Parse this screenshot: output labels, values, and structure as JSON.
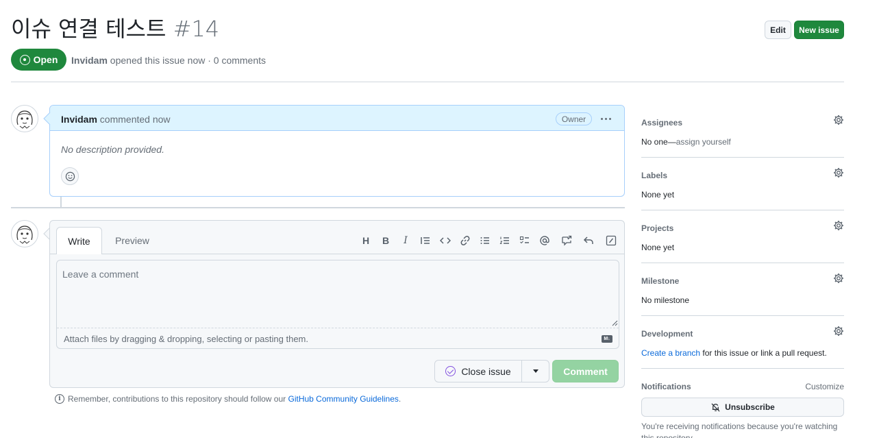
{
  "issue": {
    "title": "이슈 연결 테스트",
    "number": "#14",
    "state": "Open",
    "author": "Invidam",
    "opened_text": "opened this issue now · 0 comments"
  },
  "header_actions": {
    "edit_label": "Edit",
    "new_issue_label": "New issue"
  },
  "comment": {
    "author": "Invidam",
    "action": "commented now",
    "badge": "Owner",
    "body": "No description provided."
  },
  "composer": {
    "tab_write": "Write",
    "tab_preview": "Preview",
    "toolbar": [
      "heading-icon",
      "bold-icon",
      "italic-icon",
      "quote-icon",
      "code-icon",
      "link-icon",
      "bulleted-list-icon",
      "numbered-list-icon",
      "task-list-icon",
      "mention-icon",
      "cross-reference-icon",
      "reply-icon",
      "slash-command-icon"
    ],
    "heading_glyph": "H",
    "bold_glyph": "B",
    "italic_glyph": "I",
    "placeholder": "Leave a comment",
    "attach_text": "Attach files by dragging & dropping, selecting or pasting them.",
    "markdown_badge": "M↓",
    "close_issue_label": "Close issue",
    "comment_label": "Comment"
  },
  "guidelines": {
    "prefix": "Remember, contributions to this repository should follow our",
    "link": "GitHub Community Guidelines",
    "suffix": ".",
    "info_glyph": "i"
  },
  "sidebar": {
    "assignees": {
      "title": "Assignees",
      "value_prefix": "No one—",
      "value_link": "assign yourself"
    },
    "labels": {
      "title": "Labels",
      "value": "None yet"
    },
    "projects": {
      "title": "Projects",
      "value": "None yet"
    },
    "milestone": {
      "title": "Milestone",
      "value": "No milestone"
    },
    "development": {
      "title": "Development",
      "link": "Create a branch",
      "suffix": "for this issue or link a pull request."
    },
    "notifications": {
      "title": "Notifications",
      "customize": "Customize",
      "unsubscribe_label": "Unsubscribe",
      "note": "You're receiving notifications because you're watching this repository."
    }
  },
  "colors": {
    "open_green": "#1f883d",
    "link_blue": "#0969da",
    "comment_head": "#ddf4ff",
    "close_purple": "#8250df"
  }
}
